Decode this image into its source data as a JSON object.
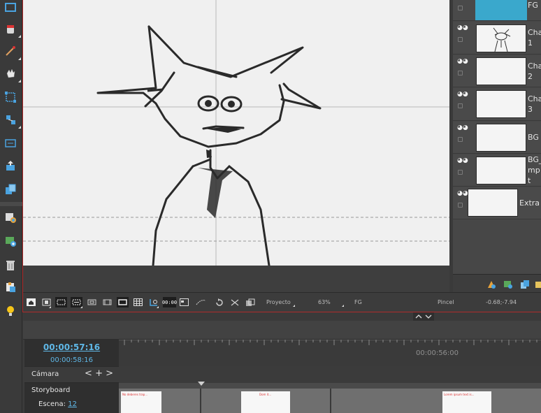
{
  "layers": [
    {
      "name": "FG",
      "selected": true
    },
    {
      "name": "Cha\n1"
    },
    {
      "name": "Cha\n2"
    },
    {
      "name": "Cha\n3"
    },
    {
      "name": "BG"
    },
    {
      "name": "BG_\nmp\nt"
    },
    {
      "name": "Extra"
    }
  ],
  "status": {
    "scope": "Proyecto",
    "zoom": "63%",
    "layer": "FG",
    "tool": "Pincel",
    "coords": "-0.68;-7.94",
    "clock": "00:00"
  },
  "timeline": {
    "time_main": "00:00:57:16",
    "time_sub": "00:00:58:16",
    "camera_label": "Cámara",
    "camera_controls": "< + >",
    "storyboard_label": "Storyboard",
    "scene_label": "Escena:",
    "scene_number": "12",
    "ruler_time": "00:00:56:00",
    "clip_texts": [
      "No deberes trap...",
      "Dom it...",
      "Lorem ipsum text is..."
    ]
  },
  "colors": {
    "accent_blue": "#5fb7e6",
    "selected_layer": "#3aa8cc",
    "focus_red": "#b02b2b"
  }
}
